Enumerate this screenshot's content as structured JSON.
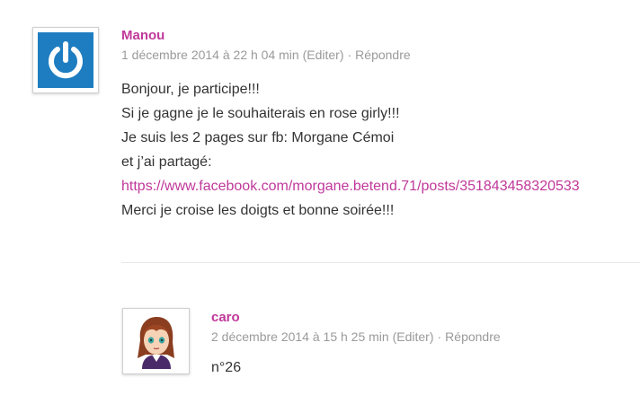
{
  "comments": [
    {
      "author": "Manou",
      "date": "1 décembre 2014 à 22 h 04 min",
      "edit": "(Editer)",
      "sep": "·",
      "reply": "Répondre",
      "lines": [
        "Bonjour, je participe!!!",
        "Si je gagne je le souhaiterais en rose girly!!!",
        "Je suis les 2 pages sur fb: Morgane Cémoi",
        "et j’ai partagé:",
        "https://www.facebook.com/morgane.betend.71/posts/351843458320533",
        "Merci je croise les doigts et bonne soirée!!!"
      ],
      "avatar_icon": "power-icon",
      "avatar_color": "#1e7dc1"
    },
    {
      "author": "caro",
      "date": "2 décembre 2014 à 15 h 25 min",
      "edit": "(Editer)",
      "sep": "·",
      "reply": "Répondre",
      "lines": [
        "n°26"
      ],
      "avatar_icon": "cartoon-girl-avatar"
    }
  ],
  "colors": {
    "author": "#c0389a",
    "link": "#c0389a",
    "meta": "#9a9a9a",
    "text": "#333333"
  }
}
